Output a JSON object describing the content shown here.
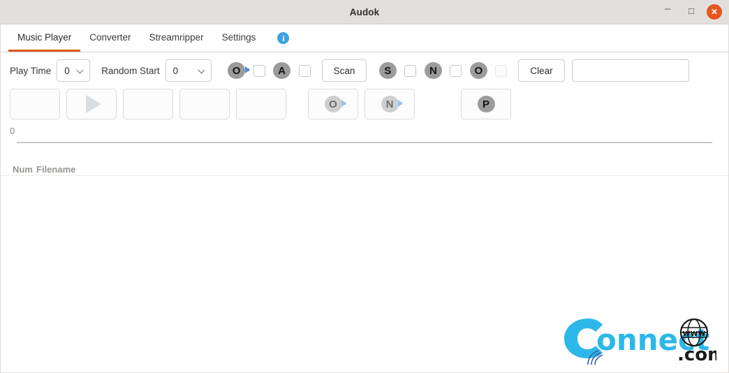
{
  "window": {
    "title": "Audok",
    "controls": {
      "minimize": "–",
      "maximize": "☐",
      "close": "✕"
    }
  },
  "tabs": [
    {
      "label": "Music Player",
      "active": true
    },
    {
      "label": "Converter",
      "active": false
    },
    {
      "label": "Streamripper",
      "active": false
    },
    {
      "label": "Settings",
      "active": false
    }
  ],
  "info_button": {
    "glyph": "i",
    "name": "info-icon"
  },
  "toolbar": {
    "play_time_label": "Play Time",
    "play_time_value": "0",
    "random_start_label": "Random Start",
    "random_start_value": "0",
    "badge_o1": "O",
    "badge_a": "A",
    "scan_label": "Scan",
    "badge_s": "S",
    "badge_n": "N",
    "badge_o2": "O",
    "clear_label": "Clear",
    "search_value": "",
    "search_placeholder": ""
  },
  "transport": {
    "buttons": [
      {
        "name": "stop-button",
        "glyph": ""
      },
      {
        "name": "play-button",
        "glyph": "▶"
      },
      {
        "name": "pause-button",
        "glyph": ""
      },
      {
        "name": "previous-button",
        "glyph": ""
      },
      {
        "name": "next-button",
        "glyph": ""
      }
    ],
    "open_label": "O",
    "new_label": "N",
    "playlist_label": "P"
  },
  "counter": {
    "value": "0"
  },
  "list": {
    "columns": [
      "Num",
      "Filename"
    ],
    "rows": []
  },
  "logo": {
    "word": "onnect",
    "big_letter": "C",
    "www": "www",
    "dotcom": ".com"
  },
  "colors": {
    "accent": "#e0571f",
    "close": "#e9551e",
    "info": "#3ca2e0",
    "logo_cyan": "#2bb8e8",
    "badge": "#9b9b9b",
    "badge_dim": "#cfcfcf",
    "arrow_blue": "#4a8fd6",
    "titlebar": "#e2e0de"
  }
}
